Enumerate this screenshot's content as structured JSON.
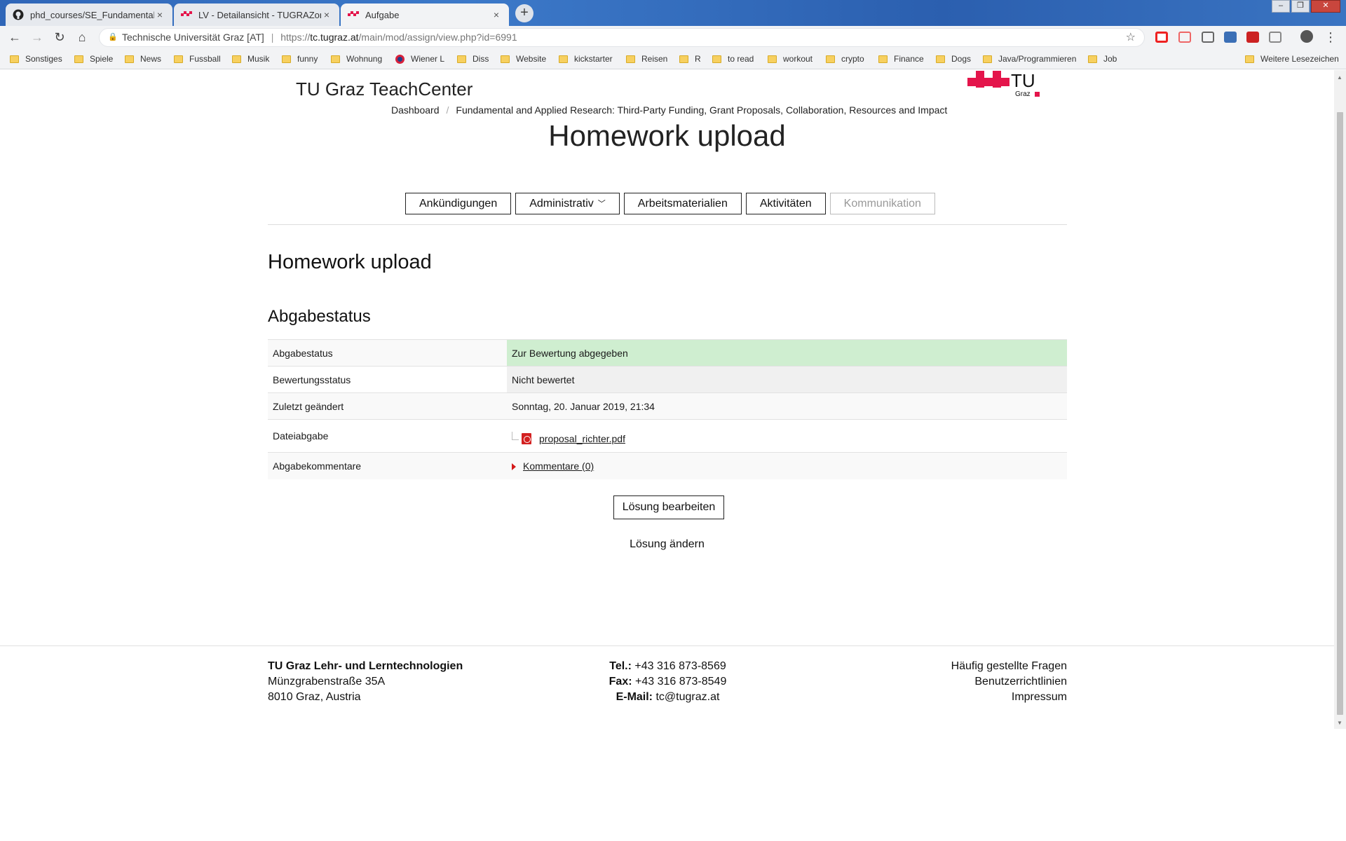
{
  "browser": {
    "tabs": [
      {
        "title": "phd_courses/SE_Fundamental_W",
        "icon": "github-icon"
      },
      {
        "title": "LV - Detailansicht - TUGRAZonlin",
        "icon": "tugraz-icon"
      },
      {
        "title": "Aufgabe",
        "icon": "tugraz-icon"
      }
    ],
    "close_glyph": "×",
    "new_tab_glyph": "+",
    "address": {
      "site_label": "Technische Universität Graz [AT]",
      "url_scheme": "https://",
      "url_host": "tc.tugraz.at",
      "url_path": "/main/mod/assign/view.php?id=6991"
    },
    "bookmarks": [
      "Sonstiges",
      "Spiele",
      "News",
      "Fussball",
      "Musik",
      "funny",
      "Wohnung",
      "Wiener L",
      "Diss",
      "Website",
      "kickstarter",
      "Reisen",
      "R",
      "to read",
      "workout",
      "crypto",
      "Finance",
      "Dogs",
      "Java/Programmieren",
      "Job"
    ],
    "other_bookmarks": "Weitere Lesezeichen"
  },
  "header": {
    "brand": "TU Graz TeachCenter",
    "logo_text": "TU",
    "logo_subtext": "Graz",
    "brand_color": "#e4154b"
  },
  "breadcrumb": {
    "home": "Dashboard",
    "course": "Fundamental and Applied Research: Third-Party Funding, Grant Proposals, Collaboration, Resources and Impact"
  },
  "page_title": "Homework upload",
  "nav_buttons": {
    "announcements": "Ankündigungen",
    "admin": "Administrativ",
    "materials": "Arbeitsmaterialien",
    "activities": "Aktivitäten",
    "communication": "Kommunikation"
  },
  "assignment": {
    "title": "Homework upload",
    "section": "Abgabestatus",
    "rows": {
      "status": {
        "label": "Abgabestatus",
        "value": "Zur Bewertung abgegeben"
      },
      "grading": {
        "label": "Bewertungsstatus",
        "value": "Nicht bewertet"
      },
      "modified": {
        "label": "Zuletzt geändert",
        "value": "Sonntag, 20. Januar 2019, 21:34"
      },
      "file": {
        "label": "Dateiabgabe",
        "value": "proposal_richter.pdf"
      },
      "comments": {
        "label": "Abgabekommentare",
        "value": "Kommentare (0)"
      }
    },
    "status_color": "#cfeed0"
  },
  "actions": {
    "edit_button": "Lösung bearbeiten",
    "change_text": "Lösung ändern"
  },
  "footer": {
    "org": "TU Graz Lehr- und Lerntechnologien",
    "street": "Münzgrabenstraße 35A",
    "city": "8010 Graz, Austria",
    "tel_label": "Tel.:",
    "tel": "+43 316 873-8569",
    "fax_label": "Fax:",
    "fax": "+43 316 873-8549",
    "email_label": "E-Mail:",
    "email": "tc@tugraz.at",
    "faq": "Häufig gestellte Fragen",
    "guidelines": "Benutzerrichtlinien",
    "imprint": "Impressum"
  }
}
